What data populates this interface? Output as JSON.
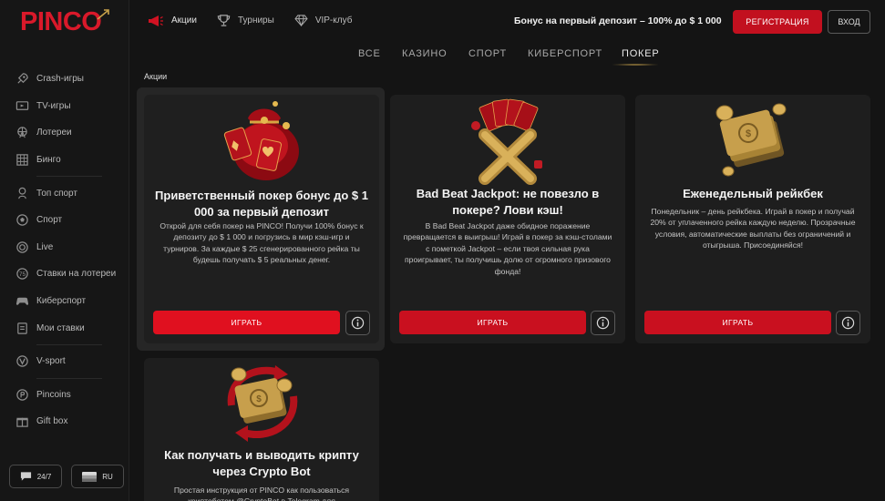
{
  "logo": {
    "text": "PINCO"
  },
  "sidebar": {
    "group1": [
      {
        "label": "Crash-игры",
        "icon": "rocket-icon"
      },
      {
        "label": "TV-игры",
        "icon": "tv-icon"
      },
      {
        "label": "Лотереи",
        "icon": "ferris-wheel-icon"
      },
      {
        "label": "Бинго",
        "icon": "bingo-card-icon"
      }
    ],
    "group2": [
      {
        "label": "Топ спорт",
        "icon": "trophy-icon"
      },
      {
        "label": "Спорт",
        "icon": "soccer-ball-icon"
      },
      {
        "label": "Live",
        "icon": "live-icon"
      },
      {
        "label": "Ставки на лотереи",
        "icon": "lottery-ball-icon"
      },
      {
        "label": "Киберспорт",
        "icon": "gamepad-icon"
      },
      {
        "label": "Мои ставки",
        "icon": "receipt-icon"
      }
    ],
    "group3": [
      {
        "label": "V-sport",
        "icon": "vsport-icon"
      }
    ],
    "group4": [
      {
        "label": "Pincoins",
        "icon": "coin-icon"
      },
      {
        "label": "Gift box",
        "icon": "gift-icon"
      }
    ],
    "support_label": "24/7",
    "language_label": "RU"
  },
  "header": {
    "links": [
      {
        "label": "Акции",
        "icon": "megaphone-icon"
      },
      {
        "label": "Турниры",
        "icon": "cup-icon"
      },
      {
        "label": "VIP-клуб",
        "icon": "diamond-icon"
      }
    ],
    "bonus_text": "Бонус на первый депозит – 100% до $ 1 000",
    "register_label": "РЕГИСТРАЦИЯ",
    "login_label": "ВХОД"
  },
  "tabs": [
    {
      "label": "ВСЕ"
    },
    {
      "label": "КАЗИНО"
    },
    {
      "label": "СПОРТ"
    },
    {
      "label": "КИБЕРСПОРТ"
    },
    {
      "label": "ПОКЕР",
      "active": true
    }
  ],
  "section_label": "Акции",
  "cards": [
    {
      "title": "Приветственный покер бонус до $ 1 000 за первый депозит",
      "description": "Открой для себя покер на PINCO! Получи 100% бонус к депозиту до $ 1 000 и погрузись в мир кэш-игр и турниров. За каждые $ 25 сгенерированного рейка ты будешь получать $ 5 реальных денег.",
      "play_label": "ИГРАТЬ",
      "art": "money-bag-cards-icon"
    },
    {
      "title": "Bad Beat Jackpot: не повезло в покере? Лови кэш!",
      "description": "В Bad Beat Jackpot даже обидное поражение превращается в выигрыш! Играй в покер за кэш-столами с пометкой Jackpot – если твоя сильная рука проигрывает, ты получишь долю от огромного призового фонда!",
      "play_label": "ИГРАТЬ",
      "art": "cards-cross-icon"
    },
    {
      "title": "Еженедельный рейкбек",
      "description": "Понедельник – день рейкбека. Играй в покер и получай 20% от уплаченного рейка каждую неделю. Прозрачные условия, автоматические выплаты без ограничений и отыгрыша. Присоединяйся!",
      "play_label": "ИГРАТЬ",
      "art": "cash-stack-icon"
    },
    {
      "title": "Как получать и выводить крипту через Crypto Bot",
      "description": "Простая инструкция от PINCO как пользоваться криптоботом @CryptoBot в Telegram для",
      "art": "cash-arrows-icon"
    }
  ],
  "colors": {
    "accent": "#c9101f",
    "gold": "#c8a24a",
    "background": "#141414",
    "card": "#1e1e1e"
  }
}
